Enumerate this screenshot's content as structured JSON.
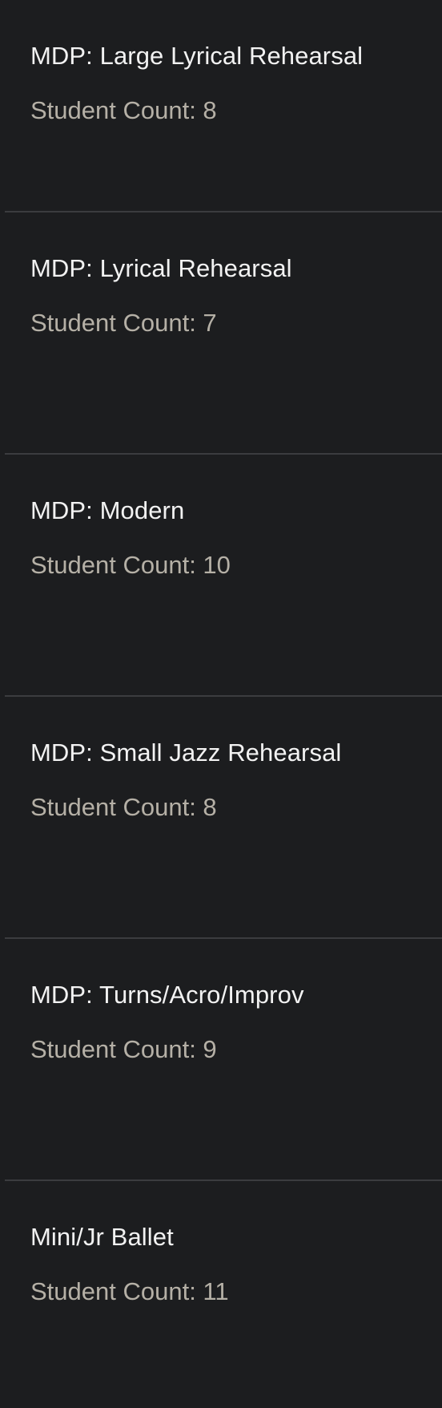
{
  "colors": {
    "background": "#1c1d1f",
    "title_text": "#f2f2f2",
    "count_text": "#b5b0a6",
    "divider": "#3b3c3f"
  },
  "classes": [
    {
      "title": "MDP: Large Lyrical Rehearsal",
      "count": "Student Count: 8"
    },
    {
      "title": "MDP: Lyrical Rehearsal",
      "count": "Student Count: 7"
    },
    {
      "title": "MDP: Modern",
      "count": "Student Count: 10"
    },
    {
      "title": "MDP: Small Jazz Rehearsal",
      "count": "Student Count: 8"
    },
    {
      "title": "MDP: Turns/Acro/Improv",
      "count": "Student Count: 9"
    },
    {
      "title": "Mini/Jr Ballet",
      "count": "Student Count: 11"
    }
  ]
}
